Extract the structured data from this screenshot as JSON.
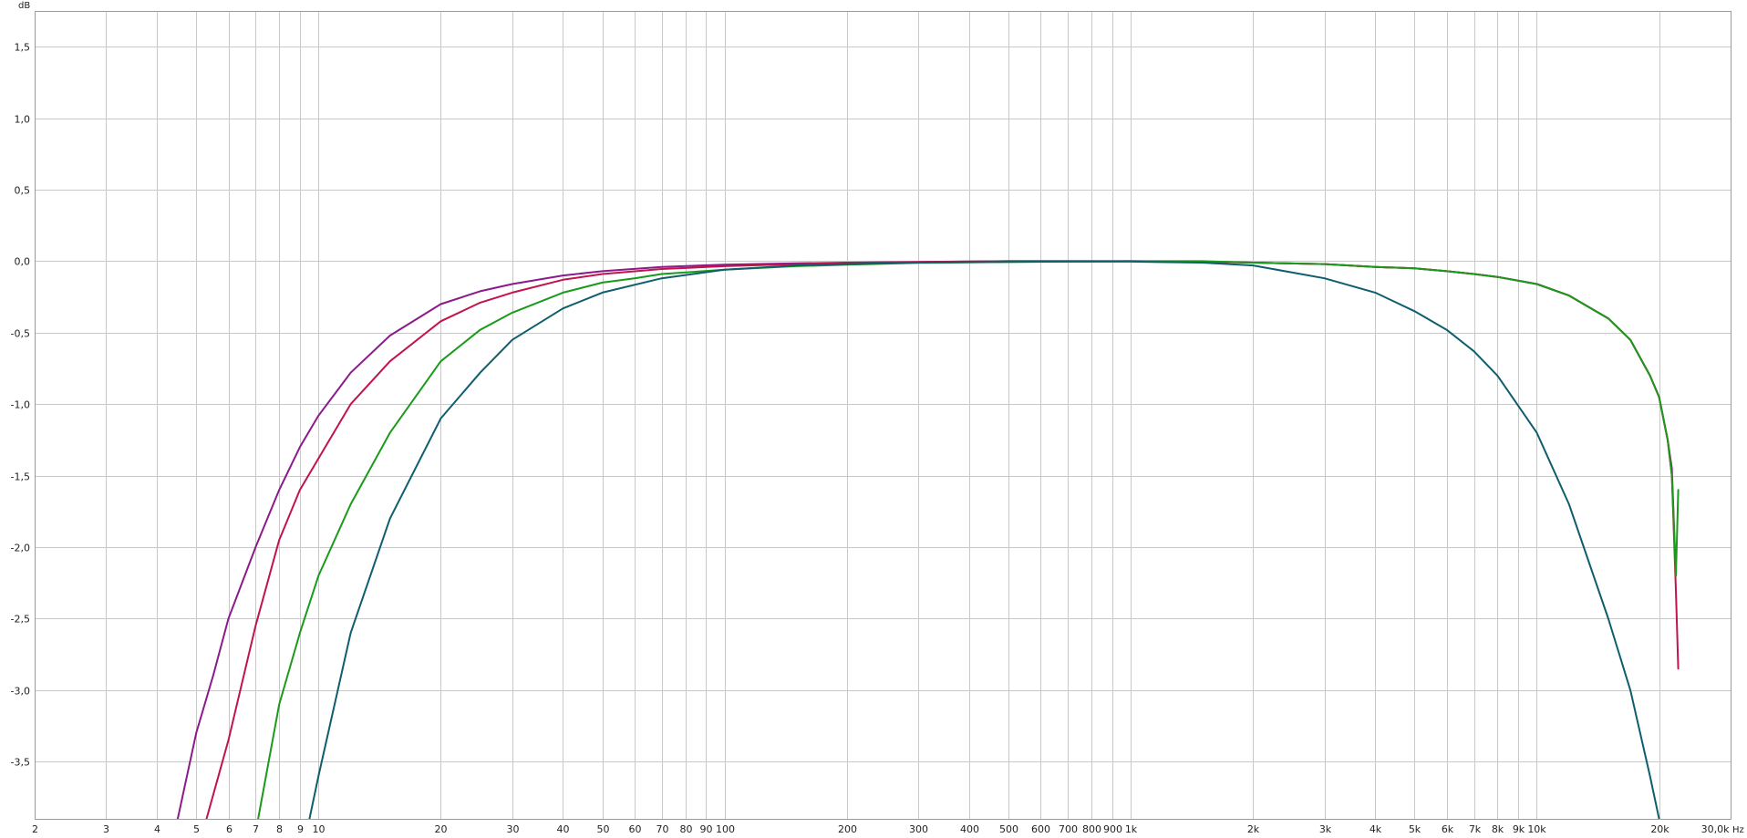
{
  "chart_data": {
    "type": "line",
    "title": "",
    "xlabel": "",
    "ylabel": "",
    "x_scale": "log",
    "xlim": [
      2,
      30000
    ],
    "ylim": [
      -3.9,
      1.75
    ],
    "grid": true,
    "y_unit_label": "dB",
    "x_unit_label": "Hz",
    "x_ticks": [
      {
        "v": 2,
        "label": "2"
      },
      {
        "v": 3,
        "label": "3"
      },
      {
        "v": 4,
        "label": "4"
      },
      {
        "v": 5,
        "label": "5"
      },
      {
        "v": 6,
        "label": "6"
      },
      {
        "v": 7,
        "label": "7"
      },
      {
        "v": 8,
        "label": "8"
      },
      {
        "v": 9,
        "label": "9"
      },
      {
        "v": 10,
        "label": "10"
      },
      {
        "v": 20,
        "label": "20"
      },
      {
        "v": 30,
        "label": "30"
      },
      {
        "v": 40,
        "label": "40"
      },
      {
        "v": 50,
        "label": "50"
      },
      {
        "v": 60,
        "label": "60"
      },
      {
        "v": 70,
        "label": "70"
      },
      {
        "v": 80,
        "label": "80"
      },
      {
        "v": 90,
        "label": "90"
      },
      {
        "v": 100,
        "label": "100"
      },
      {
        "v": 200,
        "label": "200"
      },
      {
        "v": 300,
        "label": "300"
      },
      {
        "v": 400,
        "label": "400"
      },
      {
        "v": 500,
        "label": "500"
      },
      {
        "v": 600,
        "label": "600"
      },
      {
        "v": 700,
        "label": "700"
      },
      {
        "v": 800,
        "label": "800"
      },
      {
        "v": 900,
        "label": "900"
      },
      {
        "v": 1000,
        "label": "1k"
      },
      {
        "v": 2000,
        "label": "2k"
      },
      {
        "v": 3000,
        "label": "3k"
      },
      {
        "v": 4000,
        "label": "4k"
      },
      {
        "v": 5000,
        "label": "5k"
      },
      {
        "v": 6000,
        "label": "6k"
      },
      {
        "v": 7000,
        "label": "7k"
      },
      {
        "v": 8000,
        "label": "8k"
      },
      {
        "v": 9000,
        "label": "9k"
      },
      {
        "v": 10000,
        "label": "10k"
      },
      {
        "v": 20000,
        "label": "20k"
      },
      {
        "v": 30000,
        "label": "30,0k"
      }
    ],
    "y_ticks": [
      {
        "v": 1.5,
        "label": "1,5"
      },
      {
        "v": 1.0,
        "label": "1,0"
      },
      {
        "v": 0.5,
        "label": "0,5"
      },
      {
        "v": 0.0,
        "label": "0,0"
      },
      {
        "v": -0.5,
        "label": "-0,5"
      },
      {
        "v": -1.0,
        "label": "-1,0"
      },
      {
        "v": -1.5,
        "label": "-1,5"
      },
      {
        "v": -2.0,
        "label": "-2,0"
      },
      {
        "v": -2.5,
        "label": "-2,5"
      },
      {
        "v": -3.0,
        "label": "-3,0"
      },
      {
        "v": -3.5,
        "label": "-3,5"
      }
    ],
    "series": [
      {
        "color": "#8b1a8b",
        "x": [
          4.5,
          5,
          5.5,
          6,
          7,
          8,
          9,
          10,
          12,
          15,
          20,
          25,
          30,
          40,
          50,
          70,
          100,
          150,
          200,
          300,
          500,
          1000,
          1500,
          2000,
          3000,
          4000,
          5000,
          6000,
          7000,
          8000,
          10000,
          12000,
          15000,
          17000,
          19000,
          20000,
          21000,
          21500,
          22000
        ],
        "y": [
          -3.9,
          -3.3,
          -2.9,
          -2.5,
          -2.0,
          -1.6,
          -1.3,
          -1.08,
          -0.78,
          -0.52,
          -0.3,
          -0.21,
          -0.16,
          -0.1,
          -0.07,
          -0.04,
          -0.025,
          -0.015,
          -0.01,
          -0.005,
          0,
          0,
          -0.003,
          -0.01,
          -0.02,
          -0.04,
          -0.05,
          -0.07,
          -0.09,
          -0.11,
          -0.16,
          -0.24,
          -0.4,
          -0.55,
          -0.8,
          -0.95,
          -1.25,
          -1.45,
          -2.2
        ]
      },
      {
        "color": "#c0144a",
        "x": [
          5.3,
          6,
          7,
          8,
          9,
          10,
          12,
          15,
          20,
          25,
          30,
          40,
          50,
          70,
          100,
          150,
          200,
          300,
          500,
          1000,
          1500,
          2000,
          3000,
          4000,
          5000,
          6000,
          7000,
          8000,
          10000,
          12000,
          15000,
          17000,
          19000,
          20000,
          21000,
          21500,
          22000,
          22300
        ],
        "y": [
          -3.9,
          -3.35,
          -2.55,
          -1.95,
          -1.6,
          -1.38,
          -1.0,
          -0.7,
          -0.42,
          -0.29,
          -0.22,
          -0.13,
          -0.09,
          -0.055,
          -0.035,
          -0.02,
          -0.012,
          -0.006,
          0,
          0,
          -0.003,
          -0.01,
          -0.02,
          -0.04,
          -0.05,
          -0.07,
          -0.09,
          -0.11,
          -0.16,
          -0.24,
          -0.4,
          -0.55,
          -0.8,
          -0.95,
          -1.25,
          -1.5,
          -2.3,
          -2.85
        ]
      },
      {
        "color": "#1a9a1a",
        "x": [
          7.1,
          8,
          9,
          10,
          12,
          15,
          20,
          25,
          30,
          40,
          50,
          60,
          70,
          100,
          150,
          200,
          300,
          500,
          1000,
          1500,
          2000,
          3000,
          4000,
          5000,
          6000,
          7000,
          8000,
          10000,
          12000,
          15000,
          17000,
          19000,
          20000,
          21000,
          21500,
          22000,
          22300
        ],
        "y": [
          -3.9,
          -3.1,
          -2.6,
          -2.2,
          -1.7,
          -1.2,
          -0.7,
          -0.48,
          -0.36,
          -0.22,
          -0.15,
          -0.12,
          -0.09,
          -0.06,
          -0.035,
          -0.025,
          -0.012,
          -0.005,
          0,
          0,
          -0.01,
          -0.02,
          -0.04,
          -0.05,
          -0.07,
          -0.09,
          -0.11,
          -0.16,
          -0.24,
          -0.4,
          -0.55,
          -0.8,
          -0.95,
          -1.25,
          -1.5,
          -2.2,
          -1.6
        ]
      },
      {
        "color": "#0e5e6e",
        "x": [
          9.5,
          10,
          12,
          15,
          20,
          25,
          30,
          40,
          50,
          70,
          100,
          150,
          200,
          300,
          500,
          700,
          1000,
          1500,
          2000,
          3000,
          4000,
          5000,
          6000,
          7000,
          8000,
          10000,
          12000,
          15000,
          17000,
          19000,
          20000
        ],
        "y": [
          -3.9,
          -3.6,
          -2.6,
          -1.8,
          -1.1,
          -0.78,
          -0.55,
          -0.33,
          -0.22,
          -0.12,
          -0.06,
          -0.03,
          -0.02,
          -0.01,
          -0.005,
          -0.003,
          -0.003,
          -0.01,
          -0.03,
          -0.12,
          -0.22,
          -0.35,
          -0.48,
          -0.63,
          -0.8,
          -1.2,
          -1.7,
          -2.5,
          -3.0,
          -3.6,
          -3.9
        ]
      }
    ]
  }
}
